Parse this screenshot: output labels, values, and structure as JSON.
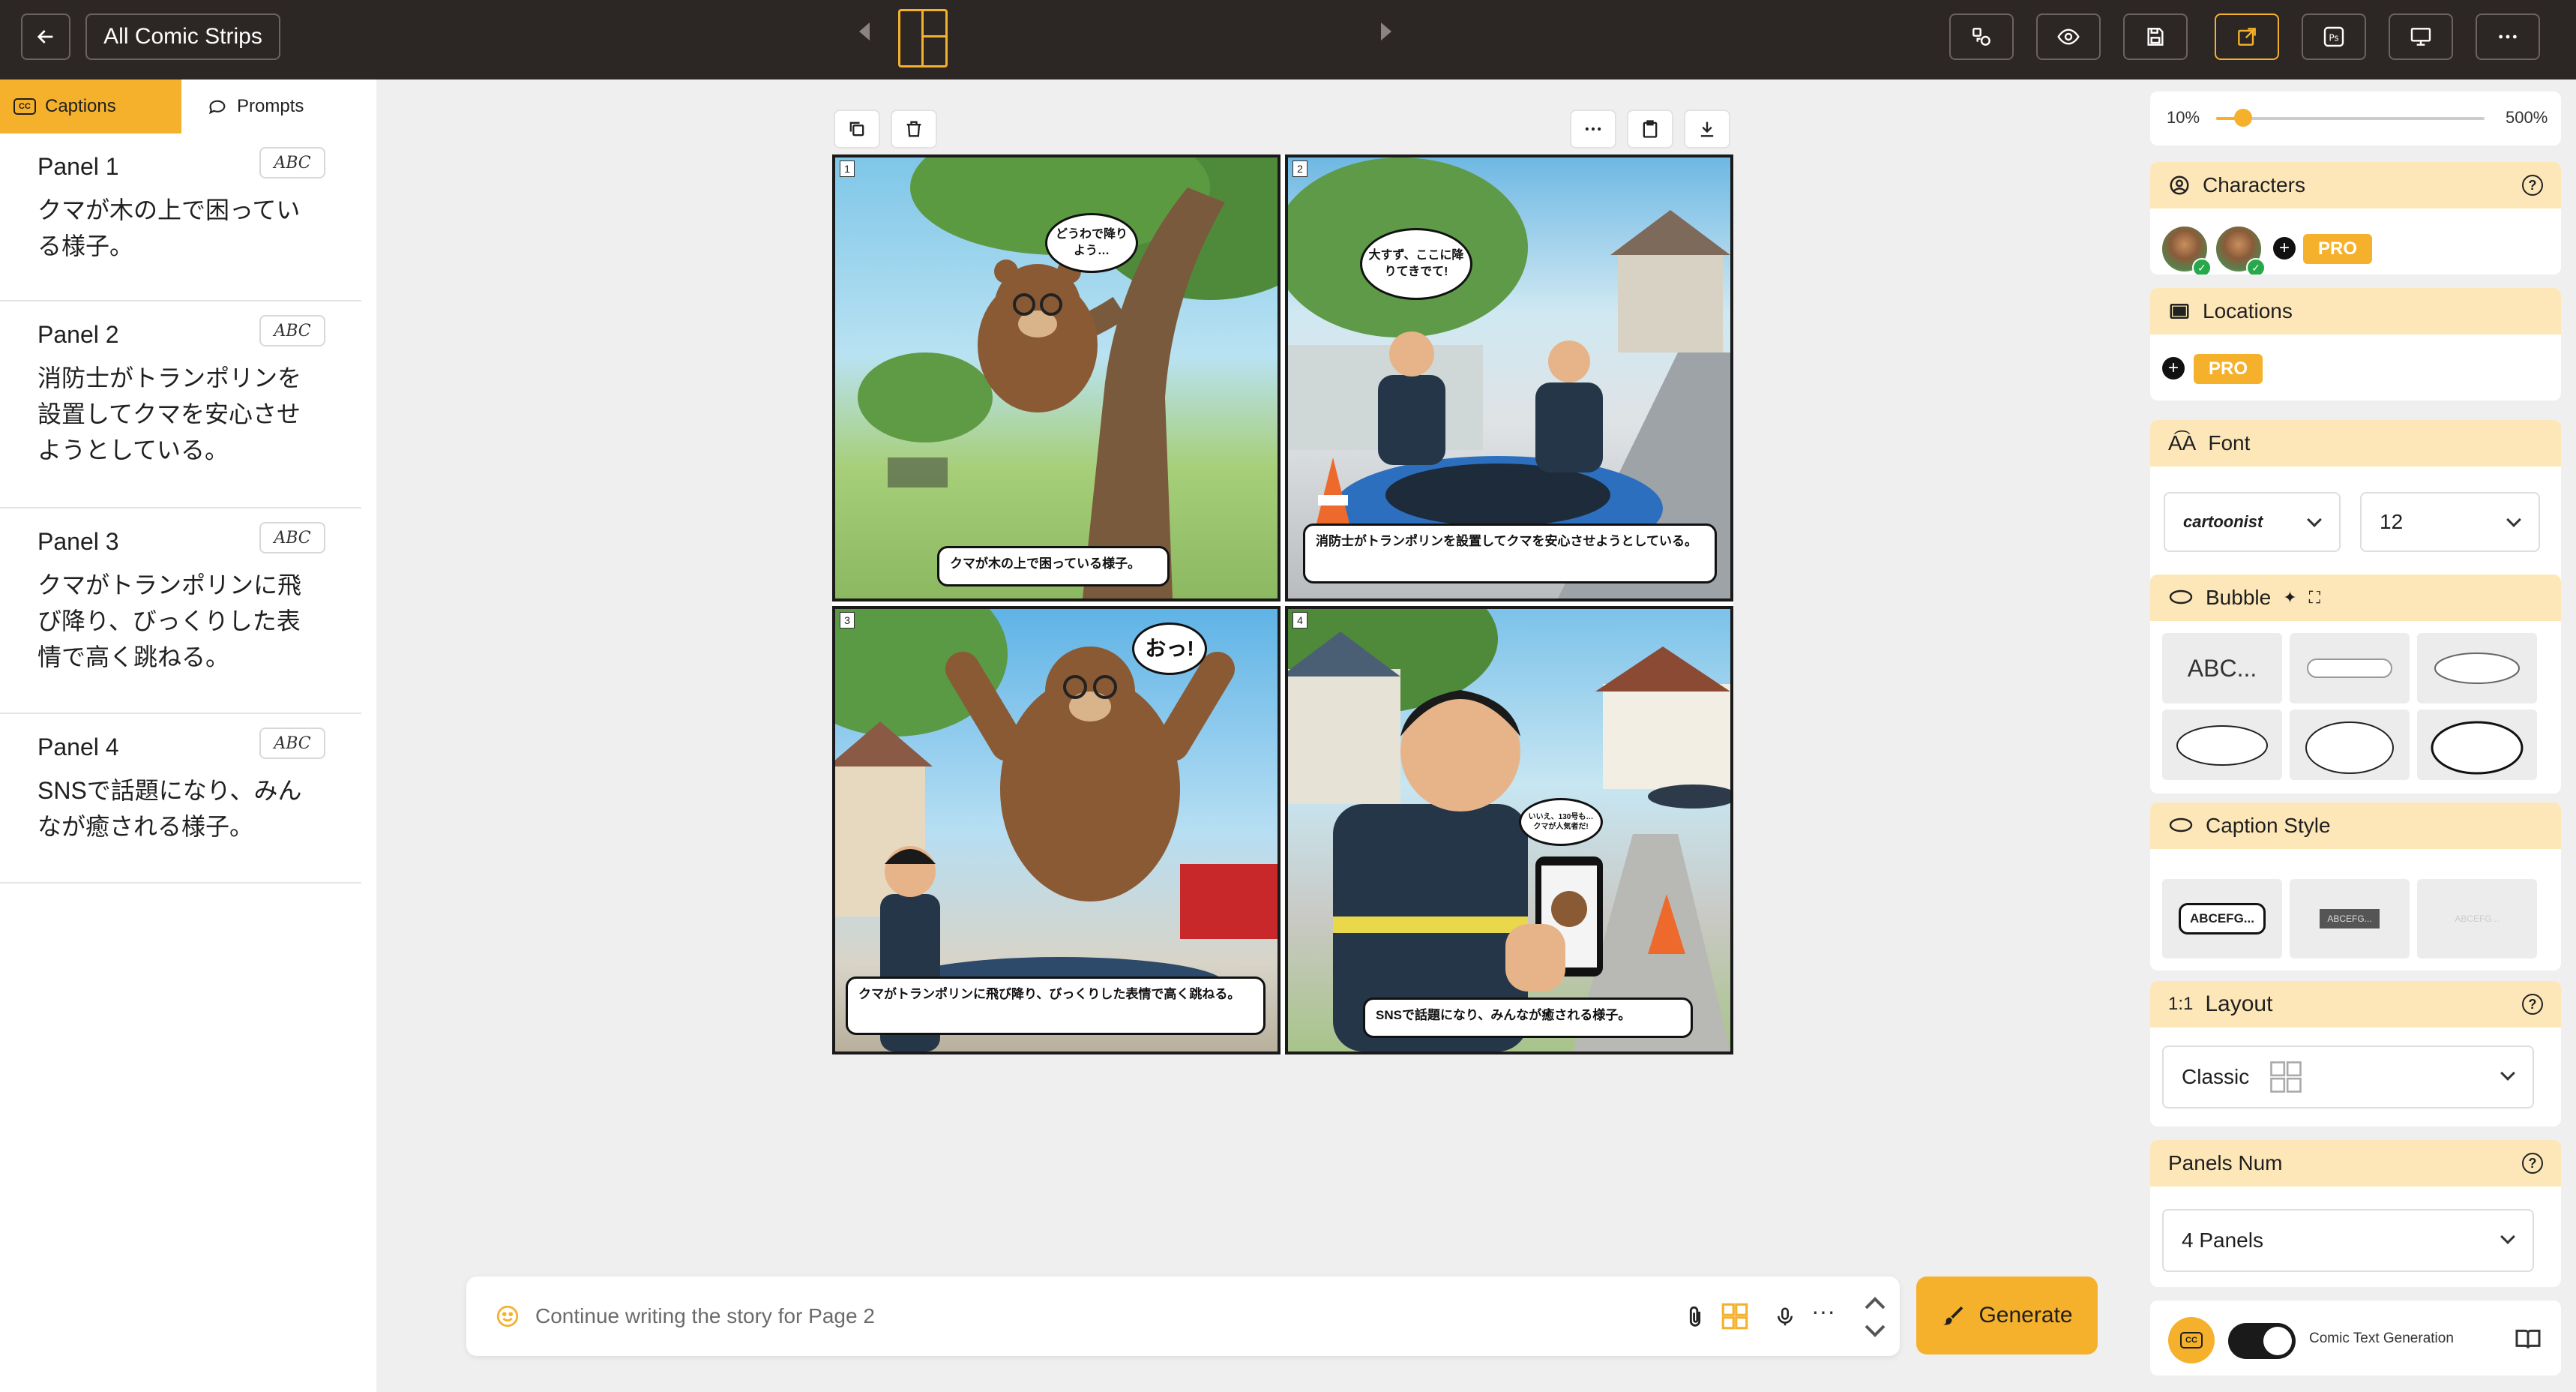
{
  "topbar": {
    "all_comic_strips": "All Comic Strips",
    "icons": [
      "back-arrow-icon",
      "shapes-icon",
      "eye-icon",
      "save-icon",
      "export-icon",
      "photoshop-icon",
      "presentation-icon",
      "more-icon"
    ]
  },
  "sidebar": {
    "tabs": [
      {
        "label": "Captions",
        "active": true
      },
      {
        "label": "Prompts",
        "active": false
      }
    ],
    "panels": [
      {
        "title": "Panel 1",
        "badge": "ABC",
        "text": "クマが木の上で困っている様子。"
      },
      {
        "title": "Panel 2",
        "badge": "ABC",
        "text": "消防士がトランポリンを設置してクマを安心させようとしている。"
      },
      {
        "title": "Panel 3",
        "badge": "ABC",
        "text": "クマがトランポリンに飛び降り、びっくりした表情で高く跳ねる。"
      },
      {
        "title": "Panel 4",
        "badge": "ABC",
        "text": "SNSで話題になり、みんなが癒される様子。"
      }
    ]
  },
  "comic": {
    "panels": [
      {
        "number": "1",
        "bubble": "どうわで降りよう…",
        "caption": "クマが木の上で困っている様子。"
      },
      {
        "number": "2",
        "bubble": "大すず、ここに降りてきでて!",
        "caption": "消防士がトランポリンを設置してクマを安心させようとしている。"
      },
      {
        "number": "3",
        "bubble": "おっ!",
        "caption": "クマがトランポリンに飛び降り、びっくりした表情で高く跳ねる。"
      },
      {
        "number": "4",
        "bubble": "いいえ、130号も…クマが人気者だ!",
        "caption": "SNSで話題になり、みんなが癒される様子。"
      }
    ]
  },
  "prompt": {
    "placeholder": "Continue writing the story for Page 2",
    "generate_label": "Generate"
  },
  "right_panel": {
    "zoom": {
      "min_label": "10%",
      "max_label": "500%",
      "fraction": 0.1
    },
    "characters": {
      "label": "Characters",
      "pro": "PRO"
    },
    "locations": {
      "label": "Locations",
      "pro": "PRO"
    },
    "font": {
      "label": "Font",
      "family": "cartoonist",
      "size": "12"
    },
    "bubble": {
      "label": "Bubble",
      "text_tile": "ABC..."
    },
    "caption_style": {
      "label": "Caption Style",
      "tiles": [
        "ABCEFG...",
        "ABCEFG...",
        "ABCEFG..."
      ]
    },
    "layout": {
      "label": "Layout",
      "ratio": "1:1",
      "selected": "Classic"
    },
    "panels_num": {
      "label": "Panels Num",
      "selected": "4 Panels"
    },
    "comic_text_generation": {
      "label": "Comic Text Generation",
      "enabled": true
    }
  },
  "colors": {
    "accent": "#f5b12c",
    "topbar": "#2c2624",
    "header_tint": "#fde7b8"
  }
}
